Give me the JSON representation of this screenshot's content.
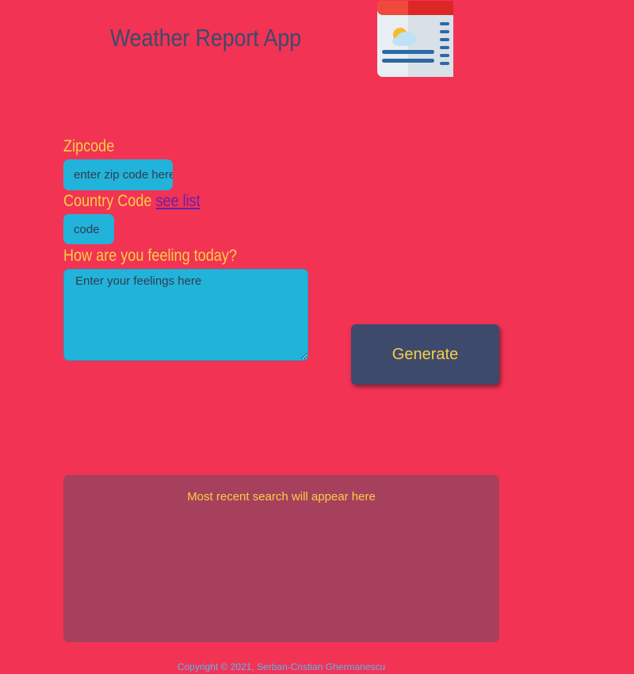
{
  "header": {
    "title": "Weather Report App",
    "logo_icon": "weather-news-icon"
  },
  "form": {
    "zipcode_label": "Zipcode",
    "zipcode_placeholder": "enter zip code here",
    "country_label": "Country Code",
    "country_link": "see list",
    "country_placeholder": "code",
    "feelings_label": "How are you feeling today?",
    "feelings_placeholder": "Enter your feelings here",
    "generate_label": "Generate"
  },
  "results": {
    "placeholder": "Most recent search will appear here"
  },
  "footer": {
    "copyright": "Copyright © 2021, Serban-Cristian Ghermanescu"
  },
  "colors": {
    "background": "#f23354",
    "title": "#3d4a6b",
    "label": "#f7cf45",
    "input": "#22b3da",
    "button": "#3e4a6b",
    "results": "#a7405c",
    "footer": "#5ab6f0",
    "link": "#6b1fa8"
  }
}
